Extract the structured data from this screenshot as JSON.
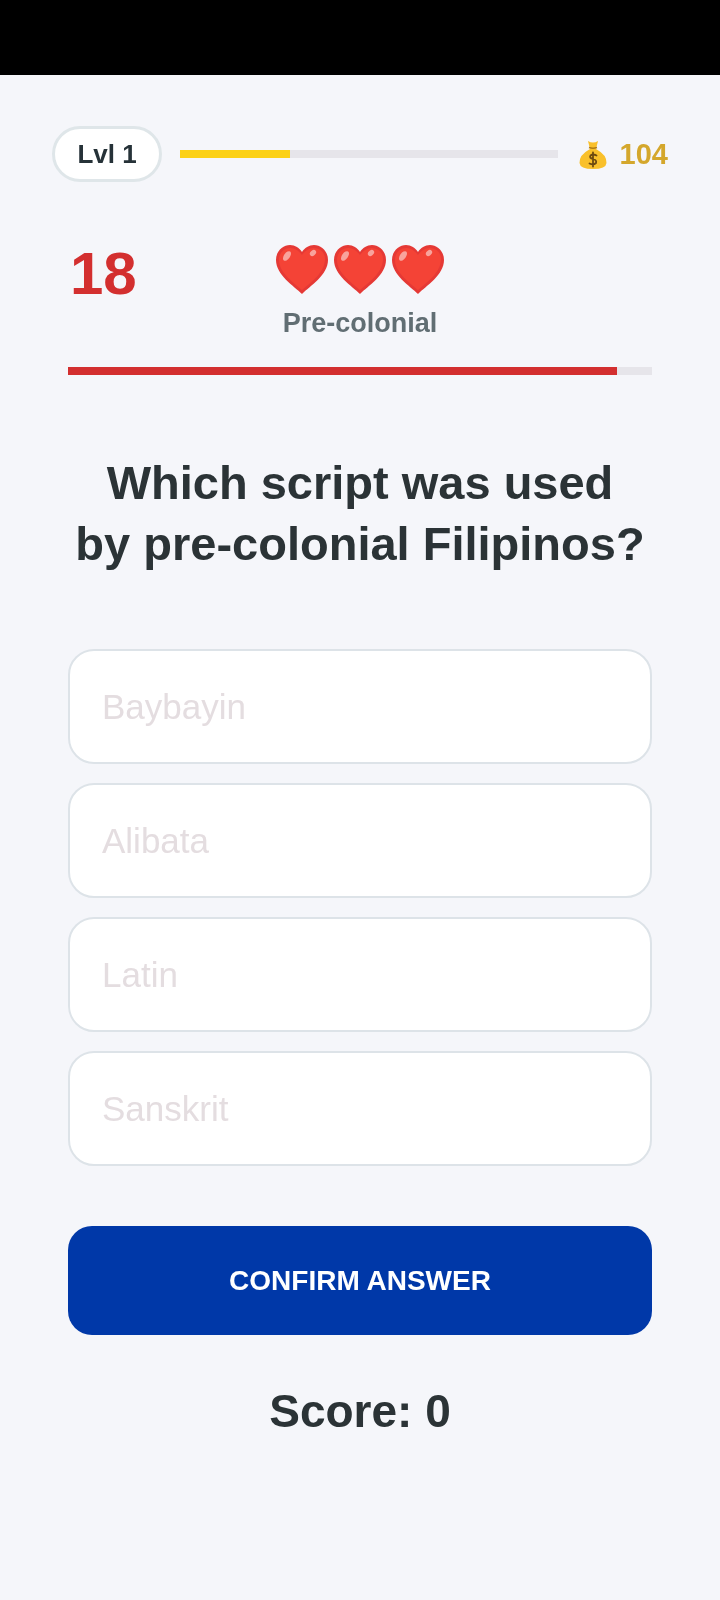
{
  "header": {
    "level_badge": "Lvl 1",
    "xp_bar": {
      "level": 0.29
    },
    "coins": "104"
  },
  "round": {
    "timer": "18",
    "lives": {
      "stars": 3
    },
    "category": "Pre-colonial",
    "time_bar": {
      "level": 0.94
    }
  },
  "question": "Which script was used by pre-colonial Filipinos?",
  "options": [
    {
      "label": "Baybayin",
      "selected": false
    },
    {
      "label": "Alibata",
      "selected": false
    },
    {
      "label": "Latin",
      "selected": false
    },
    {
      "label": "Sanskrit",
      "selected": false
    }
  ],
  "confirm_button": "CONFIRM ANSWER",
  "score": "Score: 0"
}
